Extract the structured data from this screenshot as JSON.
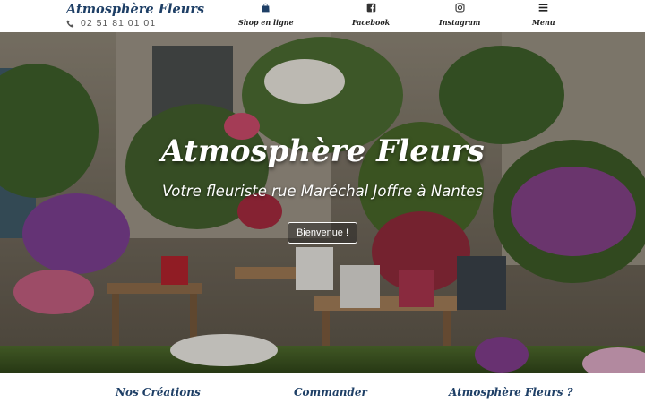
{
  "brand": {
    "name": "Atmosphère Fleurs",
    "phone": "02 51 81 01 01"
  },
  "nav": [
    {
      "label": "Shop en ligne",
      "icon": "shopping-bag-icon"
    },
    {
      "label": "Facebook",
      "icon": "facebook-icon"
    },
    {
      "label": "Instagram",
      "icon": "instagram-icon"
    },
    {
      "label": "Menu",
      "icon": "hamburger-menu-icon"
    }
  ],
  "hero": {
    "title": "Atmosphère Fleurs",
    "subtitle": "Votre fleuriste rue Maréchal Joffre à Nantes",
    "button": "Bienvenue !"
  },
  "bottom_links": [
    "Nos Créations",
    "Commander",
    "Atmosphère Fleurs ?"
  ],
  "colors": {
    "brand_blue": "#1e3f66",
    "text_dark": "#222222"
  }
}
